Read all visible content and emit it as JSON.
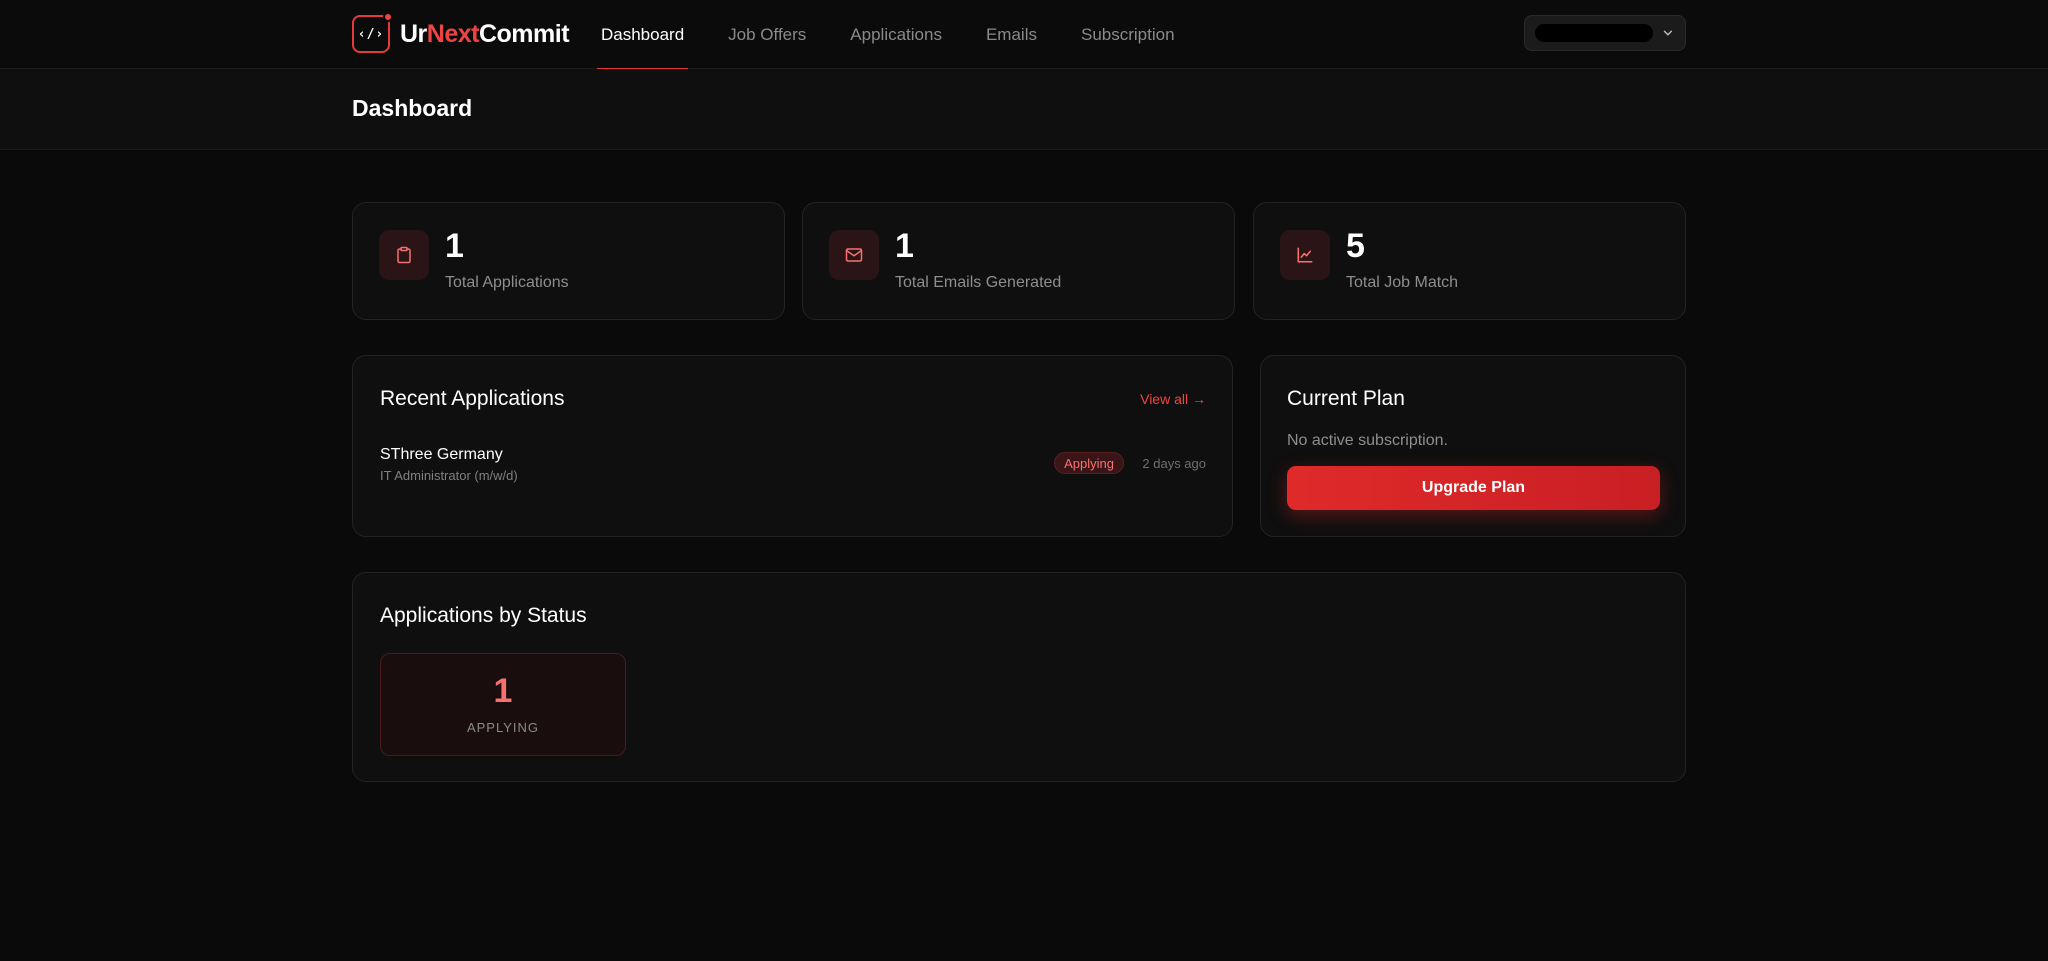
{
  "brand": {
    "mark": "‹/›",
    "name_part1": "Ur",
    "name_part2": "Next",
    "name_part3": "Commit",
    "accent_color": "#ef4444"
  },
  "nav": {
    "items": [
      {
        "label": "Dashboard",
        "active": true
      },
      {
        "label": "Job Offers",
        "active": false
      },
      {
        "label": "Applications",
        "active": false
      },
      {
        "label": "Emails",
        "active": false
      },
      {
        "label": "Subscription",
        "active": false
      }
    ]
  },
  "user_menu": {
    "icon": "chevron-down-icon"
  },
  "page": {
    "title": "Dashboard"
  },
  "stats": [
    {
      "value": "1",
      "label": "Total Applications",
      "icon": "clipboard-icon"
    },
    {
      "value": "1",
      "label": "Total Emails Generated",
      "icon": "mail-icon"
    },
    {
      "value": "5",
      "label": "Total Job Match",
      "icon": "line-chart-icon"
    }
  ],
  "recent_applications": {
    "title": "Recent Applications",
    "view_all": "View all →",
    "items": [
      {
        "company": "SThree Germany",
        "role": "IT Administrator (m/w/d)",
        "status": "Applying",
        "time": "2 days ago"
      }
    ]
  },
  "current_plan": {
    "title": "Current Plan",
    "status_text": "No active subscription.",
    "button_label": "Upgrade Plan"
  },
  "applications_by_status": {
    "title": "Applications by Status",
    "items": [
      {
        "count": "1",
        "label": "APPLYING"
      }
    ]
  }
}
